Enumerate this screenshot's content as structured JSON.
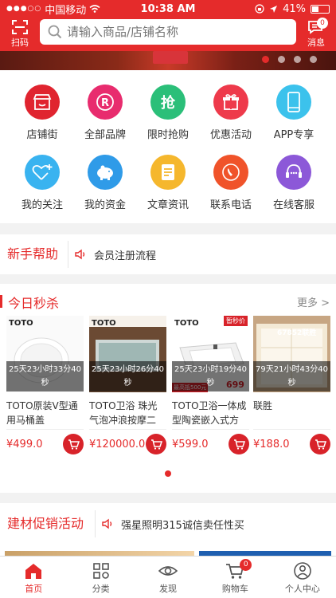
{
  "status_bar": {
    "carrier": "中国移动",
    "time": "10:38 AM",
    "battery": "41%",
    "battery_level": 0.41
  },
  "header": {
    "scan_label": "扫码",
    "search_placeholder": "请输入商品/店铺名称",
    "message_label": "消息",
    "message_count": "0"
  },
  "banner": {
    "active_dot": 0
  },
  "menu": {
    "items": [
      {
        "label": "店铺街",
        "icon": "store-icon",
        "color": "#e0242f"
      },
      {
        "label": "全部品牌",
        "icon": "brand-r-icon",
        "color": "#e82c6e"
      },
      {
        "label": "限时抢购",
        "icon": "flash-sale-icon",
        "color": "#2bbf79",
        "glyph": "抢"
      },
      {
        "label": "优惠活动",
        "icon": "gift-icon",
        "color": "#ee3a4b"
      },
      {
        "label": "APP专享",
        "icon": "phone-icon",
        "color": "#3cc2ec"
      },
      {
        "label": "我的关注",
        "icon": "heart-plus-icon",
        "color": "#39b3f0"
      },
      {
        "label": "我的资金",
        "icon": "piggy-bank-icon",
        "color": "#2f9be8"
      },
      {
        "label": "文章资讯",
        "icon": "article-icon",
        "color": "#f5b72d"
      },
      {
        "label": "联系电话",
        "icon": "phone-call-icon",
        "color": "#f0532a"
      },
      {
        "label": "在线客服",
        "icon": "customer-service-icon",
        "color": "#8c58d8"
      }
    ]
  },
  "help": {
    "title": "新手帮助",
    "notice": "会员注册流程"
  },
  "seckill": {
    "title": "今日秒杀",
    "more": "更多 >",
    "products": [
      {
        "countdown": "25天23小时33分40秒",
        "name": "TOTO原装V型通用马桶盖",
        "price": "¥499.0",
        "logo": "TOTO"
      },
      {
        "countdown": "25天23小时26分40秒",
        "name": "TOTO卫浴 珠光气泡冲浪按摩二",
        "price": "¥120000.0",
        "logo": "TOTO"
      },
      {
        "countdown": "25天23小时19分40秒",
        "name": "TOTO卫浴一体成型陶瓷嵌入式方",
        "price": "¥599.0",
        "logo": "TOTO",
        "tag": "暂秒价",
        "promo_price": "699",
        "promo_note": "最高抵500元"
      },
      {
        "countdown": "79天21小时43分40秒",
        "name": "联胜",
        "price": "¥188.0",
        "logo": "67852联胜"
      }
    ]
  },
  "promo": {
    "title": "建材促销活动",
    "notice": "强星照明315诚信卖任性买"
  },
  "tabbar": {
    "tabs": [
      {
        "label": "首页",
        "icon": "home-icon",
        "active": true
      },
      {
        "label": "分类",
        "icon": "category-icon"
      },
      {
        "label": "发现",
        "icon": "eye-icon"
      },
      {
        "label": "购物车",
        "icon": "cart-icon",
        "badge": "0"
      },
      {
        "label": "个人中心",
        "icon": "user-icon"
      }
    ]
  },
  "colors": {
    "brand": "#e52b2b",
    "text": "#333333",
    "background": "#f2f2f2"
  }
}
